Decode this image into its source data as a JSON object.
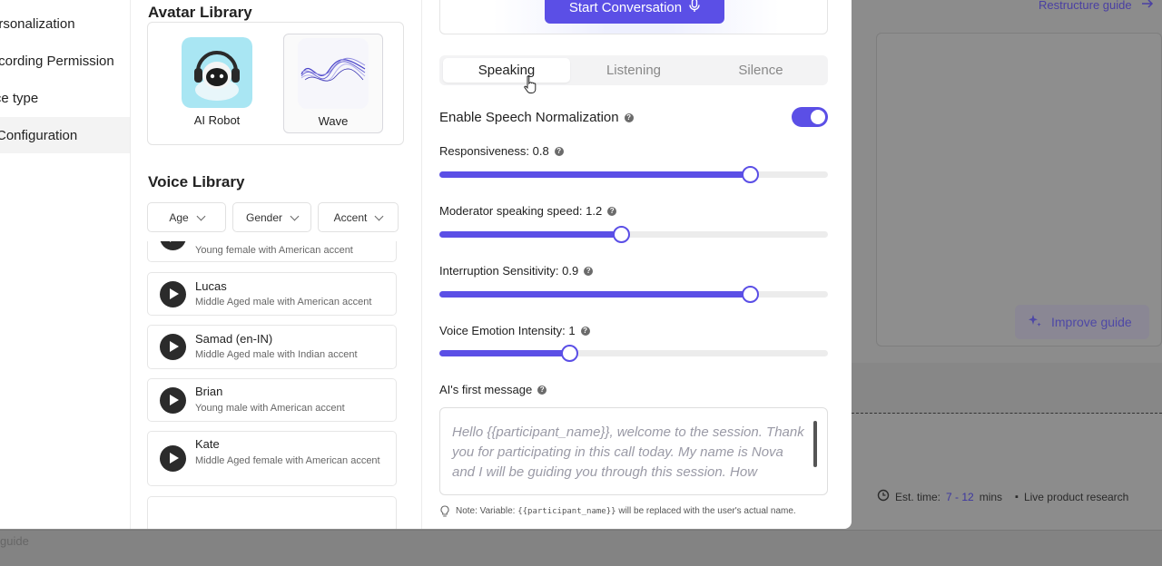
{
  "background": {
    "restructure_link": "Restructure guide",
    "improve_button": "Improve guide",
    "est_label": "Est. time:",
    "est_value": "7 - 12",
    "est_unit": "mins",
    "tag": "Live product research",
    "bottom_text": "guide"
  },
  "nav": {
    "items": [
      {
        "label": "Personalization"
      },
      {
        "label": "Recording Permission"
      },
      {
        "label": "Voice type"
      },
      {
        "label": "Configuration"
      }
    ]
  },
  "avatar_library": {
    "title": "Avatar Library",
    "items": [
      {
        "label": "AI Robot"
      },
      {
        "label": "Wave"
      }
    ]
  },
  "voice_library": {
    "title": "Voice Library",
    "filters": [
      "Age",
      "Gender",
      "Accent"
    ],
    "voices": [
      {
        "name": "",
        "desc": "Young female with American accent"
      },
      {
        "name": "Lucas",
        "desc": "Middle Aged male with American accent"
      },
      {
        "name": "Samad (en-IN)",
        "desc": "Middle Aged male with Indian accent"
      },
      {
        "name": "Brian",
        "desc": "Young male with American accent"
      },
      {
        "name": "Kate",
        "desc": "Middle Aged female with American accent"
      }
    ]
  },
  "conversation": {
    "start_button": "Start Conversation",
    "tabs": [
      "Speaking",
      "Listening",
      "Silence"
    ],
    "active_tab": "Speaking",
    "speech_normalization": {
      "label": "Enable Speech Normalization",
      "enabled": true
    },
    "sliders": [
      {
        "label": "Responsiveness: 0.8",
        "fraction": 0.8
      },
      {
        "label": "Moderator speaking speed: 1.2",
        "fraction": 0.467
      },
      {
        "label": "Interruption Sensitivity: 0.9",
        "fraction": 0.8
      },
      {
        "label": "Voice Emotion Intensity: 1",
        "fraction": 0.333
      }
    ],
    "first_message": {
      "label": "AI's first message",
      "text": "Hello {{participant_name}}, welcome to the session. Thank you for participating in this call today. My name is Nova and I will be guiding you through this session. How"
    },
    "note_prefix": "Note: Variable:",
    "note_var": "{{participant_name}}",
    "note_suffix": "will be replaced with the user's actual name."
  },
  "colors": {
    "accent": "#5b4fe6",
    "backdrop": "#8c8c8c"
  }
}
